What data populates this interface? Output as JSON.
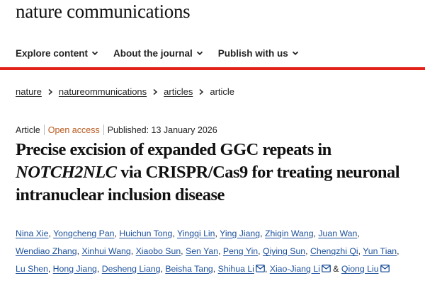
{
  "brand": {
    "name": "nature communications"
  },
  "nav": {
    "items": [
      {
        "label": "Explore content",
        "icon": "chevron-down-icon"
      },
      {
        "label": "About the journal",
        "icon": "chevron-down-icon"
      },
      {
        "label": "Publish with us",
        "icon": "chevron-down-icon"
      }
    ],
    "accent_color": "#e2231a"
  },
  "breadcrumb": {
    "items": [
      "nature",
      "natureommunications",
      "articles"
    ],
    "current": "article"
  },
  "article": {
    "type": "Article",
    "access": "Open access",
    "published": "Published: 13 January 2026",
    "title_part1": "Precise excision of expanded GGC repeats in ",
    "title_gene": "NOTCH2NLC",
    "title_part2": " via CRISPR/Cas9 for treating neuronal intranuclear inclusion disease",
    "authors": [
      "Nina Xie",
      "Yongcheng Pan",
      "Huichun Tong",
      "Yingqi Lin",
      "Ying Jiang",
      "Zhiqin Wang",
      "Juan Wan",
      "Wendiao Zhang",
      "Xinhui Wang",
      "Xiaobo Sun",
      "Sen Yan",
      "Peng Yin",
      "Qiying Sun",
      "Chengzhi Qi",
      "Yun Tian",
      "Lu Shen",
      "Hong Jiang",
      "Desheng Liang",
      "Beisha Tang",
      "Shihua Li",
      "Xiao-Jiang Li",
      "Qiong Liu"
    ],
    "conjunction": "&",
    "link_color": "#1b4f9b",
    "open_access_color": "#b95a1f"
  }
}
